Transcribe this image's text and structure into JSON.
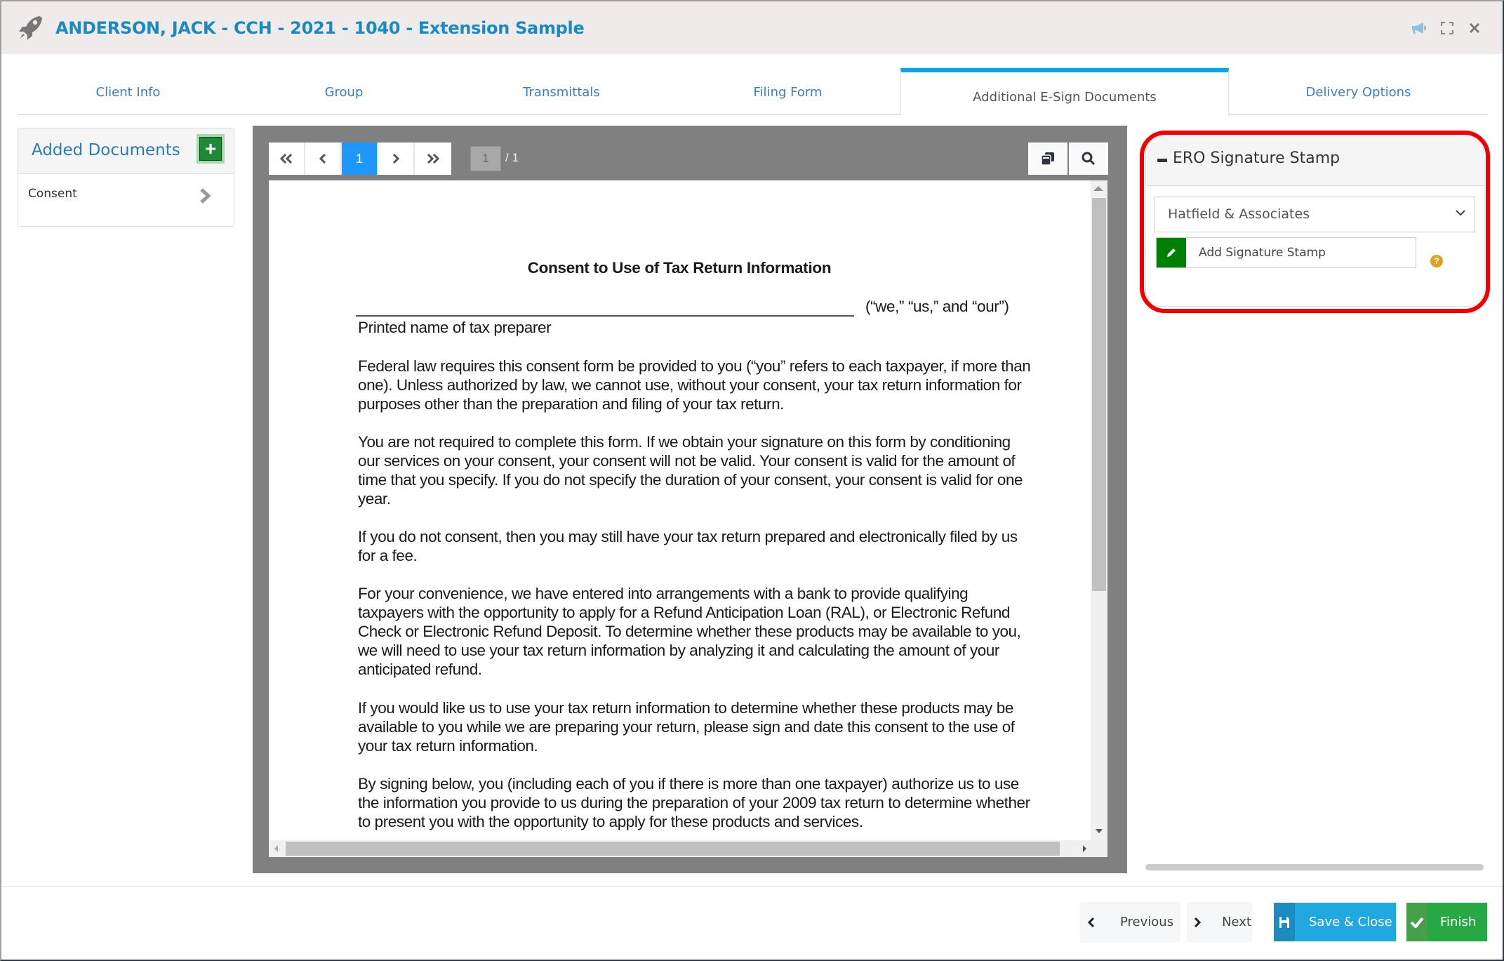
{
  "header": {
    "title": "ANDERSON, JACK - CCH - 2021 - 1040 - Extension Sample",
    "icons": [
      "rocket-icon",
      "megaphone-icon",
      "fullscreen-icon",
      "close-icon"
    ]
  },
  "tabs": [
    {
      "label": "Client Info",
      "active": false
    },
    {
      "label": "Group",
      "active": false
    },
    {
      "label": "Transmittals",
      "active": false
    },
    {
      "label": "Filing Form",
      "active": false
    },
    {
      "label": "Additional E-Sign Documents",
      "active": true
    },
    {
      "label": "Delivery Options",
      "active": false
    }
  ],
  "left_panel": {
    "title": "Added Documents",
    "add_button_label": "+",
    "documents": [
      {
        "label": "Consent"
      }
    ]
  },
  "viewer": {
    "pager": {
      "first": "«",
      "prev": "‹",
      "current": "1",
      "next": "›",
      "last": "»"
    },
    "page_input": "1",
    "page_total": "/ 1",
    "tools": [
      "pages-icon",
      "search-icon"
    ],
    "document": {
      "title": "Consent to Use of Tax Return Information",
      "we_us_our": "(“we,” “us,” and “our”)",
      "printed_name_label": "Printed name of tax preparer",
      "paragraphs": [
        "Federal law requires this consent form be provided to you (“you” refers to each taxpayer, if more than one). Unless authorized by law, we cannot use, without your consent, your tax return information for purposes other than the preparation and filing of your tax return.",
        "You are not required to complete this form. If we obtain your signature on this form by conditioning our services on your consent, your consent will not be valid. Your consent is valid for the amount of time that you specify. If you do not specify the duration of your consent, your consent is valid for one year.",
        "If you do not consent, then you may still have your tax return prepared and electronically filed by us for a fee.",
        "For your convenience, we have entered into arrangements with a bank to provide qualifying taxpayers with the opportunity to apply for a Refund Anticipation Loan (RAL), or Electronic Refund Check or Electronic Refund Deposit. To determine whether these products may be available to you, we will need to use your tax return information by analyzing it and calculating the amount of your anticipated refund.",
        "If you would like us to use your tax return information to determine whether these products may be available to you while we are preparing your return, please sign and date this consent to the use of your tax return information.",
        "By signing below, you (including each of you if there is more than one taxpayer) authorize us to use the information you provide to us during the preparation of your 2009 tax return to determine whether to present you with the opportunity to apply for these products and services."
      ]
    }
  },
  "ero_panel": {
    "title": "ERO Signature Stamp",
    "selected_ero": "Hatfield & Associates",
    "add_stamp_label": "Add Signature Stamp"
  },
  "footer": {
    "previous_label": "Previous",
    "next_label": "Next",
    "save_close_label": "Save & Close",
    "finish_label": "Finish"
  },
  "colors": {
    "brand_blue": "#1a8ac0",
    "tab_active_accent": "#00a8f0",
    "add_green": "#1e8a35",
    "highlight_red": "#f00000",
    "save_blue": "#22a8e0",
    "finish_green": "#28a745",
    "help_gold": "#e0a020"
  }
}
